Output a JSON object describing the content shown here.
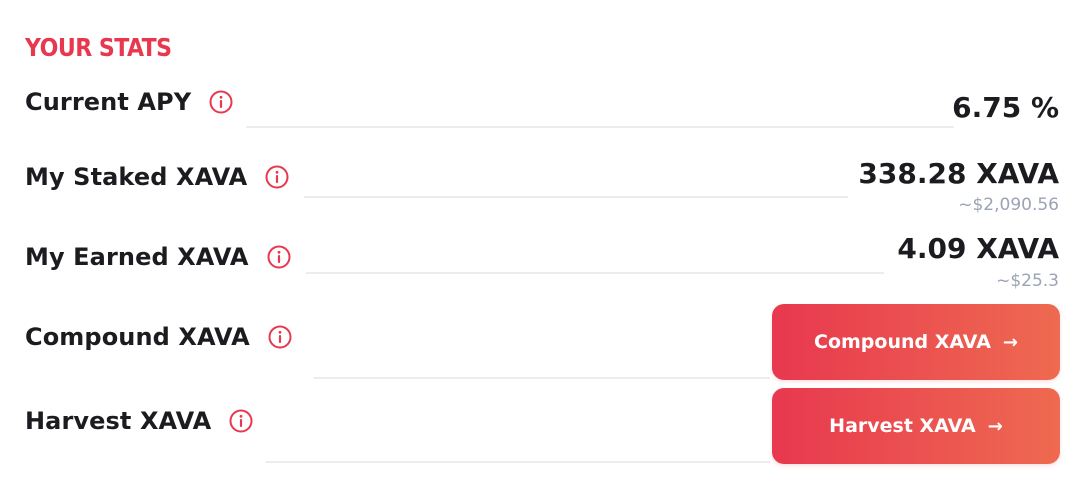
{
  "section": {
    "title": "YOUR STATS"
  },
  "rows": {
    "apy": {
      "label": "Current APY",
      "value": "6.75 %"
    },
    "staked": {
      "label": "My Staked XAVA",
      "value": "338.28 XAVA",
      "usd": "~$2,090.56"
    },
    "earned": {
      "label": "My Earned XAVA",
      "value": "4.09 XAVA",
      "usd": "~$25.3"
    },
    "compound": {
      "label": "Compound XAVA",
      "button_label": "Compound XAVA",
      "button_icon": "arrow-right"
    },
    "harvest": {
      "label": "Harvest XAVA",
      "button_label": "Harvest XAVA",
      "button_icon": "arrow-right"
    }
  },
  "colors": {
    "accent": "#e8384f",
    "accent_end": "#ee6a50",
    "muted": "#9ba3b4",
    "text": "#1c1c20"
  }
}
